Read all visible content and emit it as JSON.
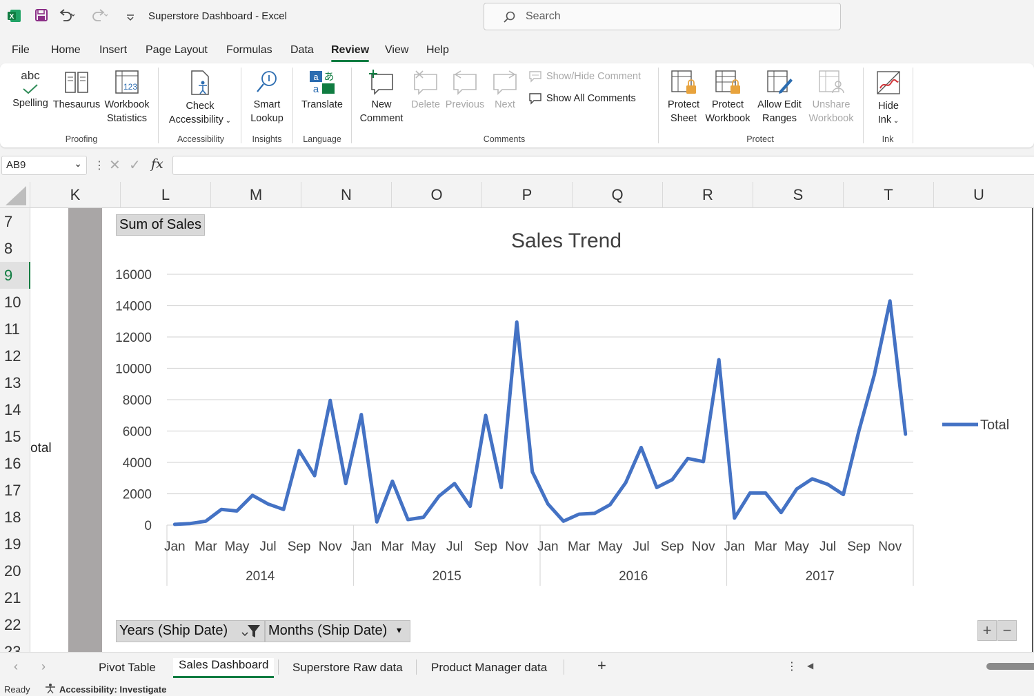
{
  "app": {
    "title": "Superstore Dashboard  -  Excel",
    "search_placeholder": "Search"
  },
  "menu_tabs": [
    "File",
    "Home",
    "Insert",
    "Page Layout",
    "Formulas",
    "Data",
    "Review",
    "View",
    "Help"
  ],
  "active_tab": "Review",
  "ribbon": {
    "proofing": {
      "label": "Proofing",
      "spelling": "Spelling",
      "thesaurus": "Thesaurus",
      "workbook_stats_1": "Workbook",
      "workbook_stats_2": "Statistics",
      "abc": "abc"
    },
    "accessibility": {
      "label": "Accessibility",
      "check_1": "Check",
      "check_2": "Accessibility"
    },
    "insights": {
      "label": "Insights",
      "smart_1": "Smart",
      "smart_2": "Lookup"
    },
    "language": {
      "label": "Language",
      "translate": "Translate"
    },
    "comments": {
      "label": "Comments",
      "new_1": "New",
      "new_2": "Comment",
      "delete": "Delete",
      "previous": "Previous",
      "next": "Next",
      "show_hide": "Show/Hide Comment",
      "show_all": "Show All Comments"
    },
    "protect": {
      "label": "Protect",
      "sheet_1": "Protect",
      "sheet_2": "Sheet",
      "workbook_1": "Protect",
      "workbook_2": "Workbook",
      "allow_1": "Allow Edit",
      "allow_2": "Ranges",
      "unshare_1": "Unshare",
      "unshare_2": "Workbook"
    },
    "ink": {
      "label": "Ink",
      "hide_1": "Hide",
      "hide_2": "Ink"
    }
  },
  "formula_bar": {
    "name_box": "AB9",
    "fx": "fx",
    "value": ""
  },
  "columns": [
    "K",
    "L",
    "M",
    "N",
    "O",
    "P",
    "Q",
    "R",
    "S",
    "T",
    "U"
  ],
  "rows": [
    "7",
    "8",
    "9",
    "10",
    "11",
    "12",
    "13",
    "14",
    "15",
    "16",
    "17",
    "18",
    "19",
    "20",
    "21",
    "22",
    "23"
  ],
  "active_row": "9",
  "cut_label": "otal",
  "pivot": {
    "values_button": "Sum of Sales",
    "years_button": "Years (Ship Date)",
    "months_button": "Months (Ship Date)",
    "plus": "+",
    "minus": "−"
  },
  "chart_data": {
    "type": "line",
    "title": "Sales Trend",
    "ylim": [
      0,
      16000
    ],
    "yticks": [
      0,
      2000,
      4000,
      6000,
      8000,
      10000,
      12000,
      14000,
      16000
    ],
    "month_tick_labels": [
      "Jan",
      "Mar",
      "May",
      "Jul",
      "Sep",
      "Nov"
    ],
    "years": [
      "2014",
      "2015",
      "2016",
      "2017"
    ],
    "legend": "Total",
    "legend_position": "right",
    "line_color": "#4472c4",
    "series": [
      {
        "name": "Total",
        "values": [
          50,
          100,
          250,
          1000,
          900,
          1900,
          1350,
          1000,
          4750,
          3150,
          7950,
          2650,
          7050,
          200,
          2800,
          350,
          500,
          1850,
          2650,
          1200,
          7000,
          2400,
          12950,
          3400,
          1350,
          250,
          700,
          750,
          1300,
          2700,
          4950,
          2400,
          2900,
          4250,
          4050,
          10550,
          450,
          2050,
          2050,
          800,
          2300,
          2950,
          2600,
          1950,
          6000,
          9600,
          14300,
          5800
        ]
      }
    ]
  },
  "sheet_tabs": [
    "Pivot Table",
    "Sales Dashboard",
    "Superstore Raw data",
    "Product Manager data"
  ],
  "active_sheet": "Sales Dashboard",
  "status": {
    "ready": "Ready",
    "accessibility": "Accessibility: Investigate"
  }
}
